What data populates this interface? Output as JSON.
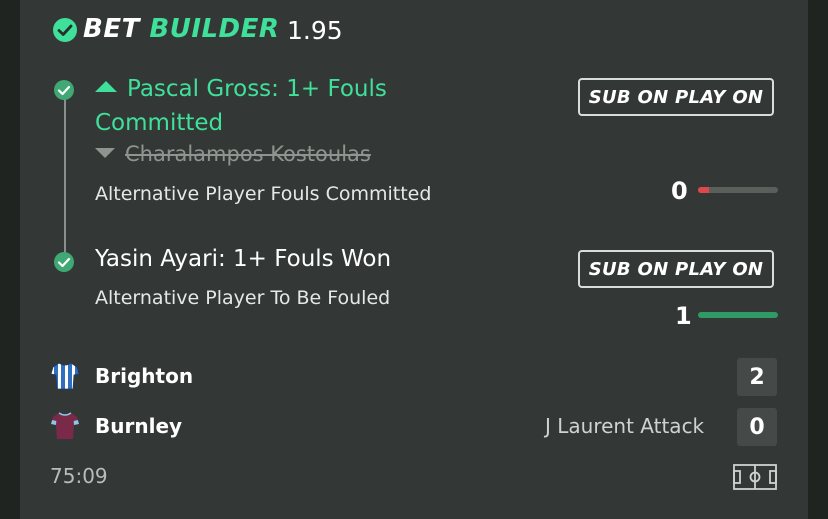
{
  "header": {
    "title_part1": "BET",
    "title_part2": "BUILDER",
    "odds": "1.95",
    "check_icon": "check-circle-icon"
  },
  "legs": [
    {
      "title": "Pascal Gross: 1+ Fouls Committed",
      "original_player": "Charalampos Kostoulas",
      "description": "Alternative Player Fouls Committed",
      "button_label": "SUB ON PLAY ON",
      "progress_value": "0",
      "progress_fraction": 0.14,
      "progress_color": "#e0474c"
    },
    {
      "title": "Yasin Ayari: 1+ Fouls Won",
      "description": "Alternative Player To Be Fouled",
      "button_label": "SUB ON PLAY ON",
      "progress_value": "1",
      "progress_fraction": 1.0,
      "progress_color": "#2f9a63"
    }
  ],
  "match": {
    "home_team": "Brighton",
    "home_score": "2",
    "away_team": "Burnley",
    "away_score": "0",
    "status": "J Laurent Attack",
    "clock": "75:09",
    "pitch_icon": "pitch-icon"
  },
  "colors": {
    "accent": "#3fe09a",
    "card_bg": "#333836",
    "page_bg": "#1f2421"
  }
}
